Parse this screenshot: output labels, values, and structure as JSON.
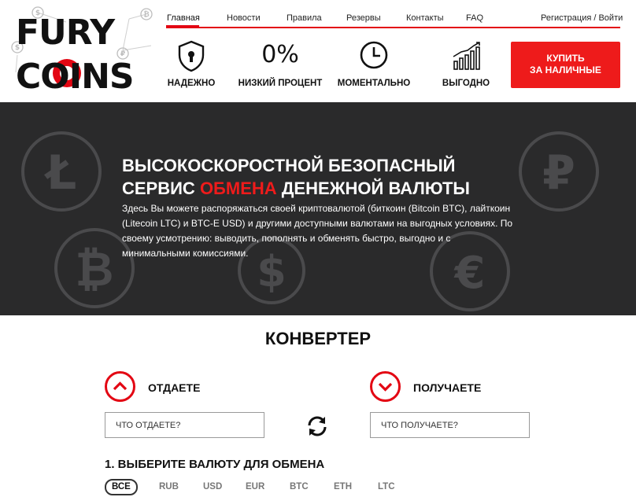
{
  "logo": {
    "line1": "FURY",
    "line2": "COINS"
  },
  "nav": {
    "items": [
      {
        "label": "Главная",
        "active": true
      },
      {
        "label": "Новости"
      },
      {
        "label": "Правила"
      },
      {
        "label": "Резервы"
      },
      {
        "label": "Контакты"
      },
      {
        "label": "FAQ"
      }
    ],
    "auth_label": "Регистрация / Войти"
  },
  "features": [
    {
      "icon": "shield-lock-icon",
      "label": "НАДЕЖНО"
    },
    {
      "icon": "percent-text",
      "value": "0%",
      "label": "НИЗКИЙ ПРОЦЕНТ"
    },
    {
      "icon": "clock-icon",
      "label": "МОМЕНТАЛЬНО"
    },
    {
      "icon": "growth-chart-icon",
      "label": "ВЫГОДНО"
    }
  ],
  "buy_button": {
    "line1": "КУПИТЬ",
    "line2": "ЗА НАЛИЧНЫЕ"
  },
  "hero": {
    "title_line1": "ВЫСОКОСКОРОСТНОЙ БЕЗОПАСНЫЙ",
    "title_line2_pre": "СЕРВИС ",
    "title_line2_accent": "ОБМЕНА",
    "title_line2_post": " ДЕНЕЖНОЙ ВАЛЮТЫ",
    "text": "Здесь Вы можете распоряжаться своей криптовалютой (биткоин (Bitcoin BTC), лайткоин (Litecoin LTC) и BTC-E USD) и другими доступными валютами на выгодных условиях. По своему усмотрению: выводить, пополнять и обменять быстро, выгодно и с минимальными комиссиями."
  },
  "converter": {
    "title": "КОНВЕРТЕР",
    "give_label": "ОТДАЕТЕ",
    "receive_label": "ПОЛУЧАЕТЕ",
    "give_placeholder": "ЧТО ОТДАЕТЕ?",
    "receive_placeholder": "ЧТО ПОЛУЧАЕТЕ?",
    "step_title": "1. ВЫБЕРИТЕ ВАЛЮТУ ДЛЯ ОБМЕНА",
    "filters": [
      "ВСЕ",
      "RUB",
      "USD",
      "EUR",
      "BTC",
      "ETH",
      "LTC"
    ],
    "active_filter": "ВСЕ"
  },
  "colors": {
    "accent": "#e30613",
    "button": "#ee1b1b",
    "hero_bg": "#2a2a2b"
  }
}
